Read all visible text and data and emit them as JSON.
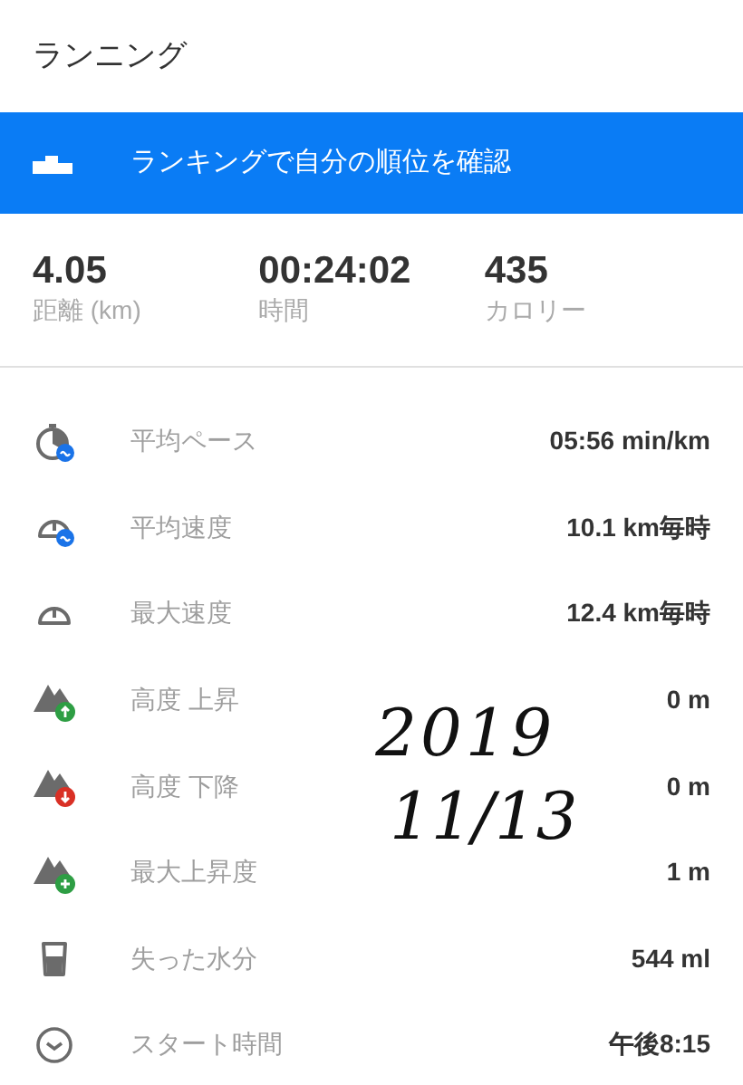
{
  "title": "ランニング",
  "banner": {
    "label": "ランキングで自分の順位を確認"
  },
  "summary": [
    {
      "value": "4.05",
      "label": "距離 (km)"
    },
    {
      "value": "00:24:02",
      "label": "時間"
    },
    {
      "value": "435",
      "label": "カロリー"
    }
  ],
  "stats": [
    {
      "kind": "pace",
      "label": "平均ペース",
      "value": "05:56 min/km"
    },
    {
      "kind": "avg_speed",
      "label": "平均速度",
      "value": "10.1 km毎時"
    },
    {
      "kind": "max_speed",
      "label": "最大速度",
      "value": "12.4 km毎時"
    },
    {
      "kind": "ascent",
      "label": "高度 上昇",
      "value": "0 m"
    },
    {
      "kind": "descent",
      "label": "高度 下降",
      "value": "0 m"
    },
    {
      "kind": "max_ascent",
      "label": "最大上昇度",
      "value": "1 m"
    },
    {
      "kind": "water",
      "label": "失った水分",
      "value": "544 ml"
    },
    {
      "kind": "clock",
      "label": "スタート時間",
      "value": "午後8:15"
    }
  ],
  "handwritten_note": [
    "2019",
    "11/13"
  ]
}
